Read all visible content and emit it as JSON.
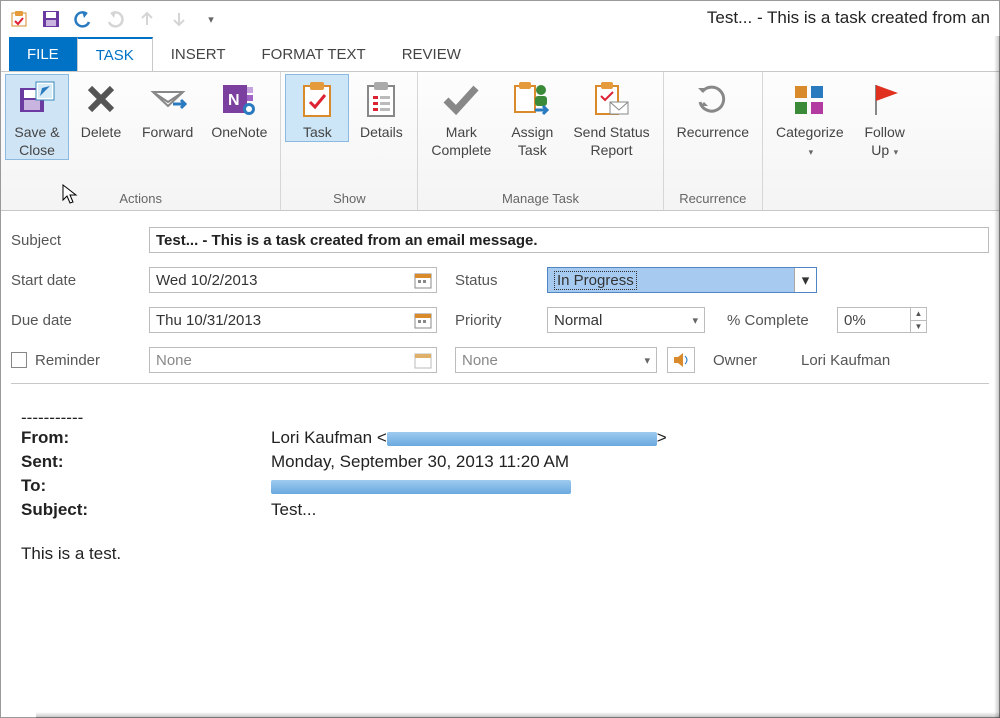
{
  "window": {
    "title": "Test... - This is a task created from an"
  },
  "tabs": {
    "file": "FILE",
    "task": "TASK",
    "insert": "INSERT",
    "format": "FORMAT TEXT",
    "review": "REVIEW"
  },
  "ribbon": {
    "actions": {
      "label": "Actions",
      "save": "Save &\nClose",
      "delete": "Delete",
      "forward": "Forward",
      "onenote": "OneNote"
    },
    "show": {
      "label": "Show",
      "task": "Task",
      "details": "Details"
    },
    "manage": {
      "label": "Manage Task",
      "mark": "Mark\nComplete",
      "assign": "Assign\nTask",
      "send": "Send Status\nReport"
    },
    "recurrence": {
      "label": "Recurrence",
      "recurrence": "Recurrence"
    },
    "tags": {
      "categorize": "Categorize",
      "followup": "Follow\nUp"
    }
  },
  "form": {
    "subject_lbl": "Subject",
    "subject": "Test... - This is a task created from an email message.",
    "start_lbl": "Start date",
    "start": "Wed 10/2/2013",
    "due_lbl": "Due date",
    "due": "Thu 10/31/2013",
    "status_lbl": "Status",
    "status": "In Progress",
    "priority_lbl": "Priority",
    "priority": "Normal",
    "pct_lbl": "% Complete",
    "pct": "0%",
    "reminder_lbl": "Reminder",
    "reminder_date": "None",
    "reminder_time": "None",
    "owner_lbl": "Owner",
    "owner": "Lori Kaufman"
  },
  "body": {
    "sep": "-----------",
    "from_k": "From:",
    "from_v": "Lori Kaufman <",
    "from_end": ">",
    "sent_k": "Sent:",
    "sent_v": "Monday, September 30, 2013 11:20 AM",
    "to_k": "To:",
    "subj_k": "Subject:",
    "subj_v": "Test...",
    "text": "This is a test."
  }
}
